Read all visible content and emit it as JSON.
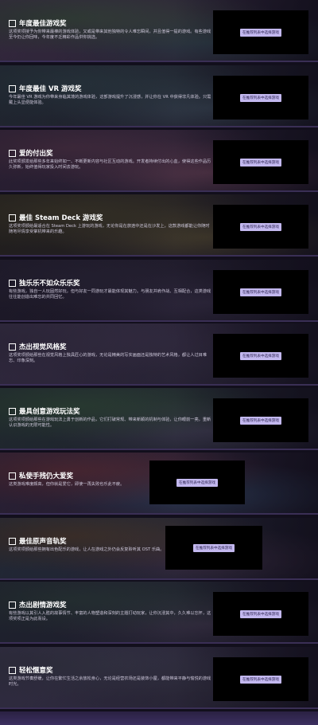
{
  "awards": [
    {
      "title": "年度最佳游戏奖",
      "description": "这项奖项授予为你带来最棒的游戏体验，又或是带来其他独特的令人难忘瞬间，并且值得一提的游戏。有些游戏至今仍让你回味，今年度不乏精彩作品供你挑选。",
      "button": "在推荐列表中选择游戏",
      "colors": [
        "#3b4a3f",
        "#2f3d48",
        "#4a3a55"
      ]
    },
    {
      "title": "年度最佳 VR 游戏奖",
      "description": "今年最佳 VR 游戏为你带来身临其境的游戏体验，这部游戏提升了沉浸感，并让你在 VR 中获得非凡体验。只需戴上头显便能体验。",
      "button": "在推荐列表中选择游戏",
      "colors": [
        "#2e3d45",
        "#36414f",
        "#2c3640"
      ]
    },
    {
      "title": "爱的付出奖",
      "description": "此奖项颁发给那些多年来始终如一、不断更新内容与社区互动的游戏。开发者持续付出的心血，使得这些作品历久弥新，始终值得玩家投入时间去游玩。",
      "button": "在推荐列表中选择游戏",
      "colors": [
        "#4d3347",
        "#5a3a4e",
        "#3a2c44"
      ]
    },
    {
      "title": "最佳 Steam Deck 游戏奖",
      "description": "这项奖项颁给最适合在 Steam Deck 上游玩的游戏，无论你是在旅途中还是在沙发上，这款游戏都能让你随时随地尽情享受掌机带来的乐趣。",
      "button": "在推荐列表中选择游戏",
      "colors": [
        "#3f3a2a",
        "#4a4230",
        "#2f2c25"
      ]
    },
    {
      "title": "独乐乐不如众乐乐奖",
      "description": "有些游戏，独自一人玩固然好玩，但与好友一同游玩才最能体现其魅力。与朋友并肩作战、互相配合，这类游戏往往能创造出难忘的共同回忆。",
      "button": "在推荐列表中选择游戏",
      "colors": [
        "#2b2638",
        "#332c42",
        "#272233"
      ]
    },
    {
      "title": "杰出视觉风格奖",
      "description": "这项奖项颁给那些在视觉风格上独具匠心的游戏，无论是精美的写实画面还是独特的艺术风格，都让人过目难忘、印象深刻。",
      "button": "在推荐列表中选择游戏",
      "colors": [
        "#3a3248",
        "#2f2a3d",
        "#443a55"
      ]
    },
    {
      "title": "最具创意游戏玩法奖",
      "description": "这项奖项颁给那些在游戏玩法上勇于创新的作品，它们打破常规、带来新颖的机制与体验，让你眼前一亮，重新认识游戏的无限可能性。",
      "button": "在推荐列表中选择游戏",
      "colors": [
        "#324a3a",
        "#3d3a4f",
        "#2c3a3f"
      ]
    },
    {
      "title": "私使手残仍大爱奖",
      "description": "这类游戏难度颇高，但你就是爱它，即使一再失败也乐此不疲。",
      "button": "在推荐列表中选择游戏",
      "colors": [
        "#5a2f3a",
        "#2f3f5a",
        "#3a2d47"
      ]
    },
    {
      "title": "最佳原声音轨奖",
      "description": "这项奖项颁给那些拥有出色配乐的游戏，让人在游戏之外仍会反复聆听其 OST 乐曲。",
      "button": "在推荐列表中选择游戏",
      "colors": [
        "#4a3a2f",
        "#3d2f45",
        "#2f3a4a"
      ]
    },
    {
      "title": "杰出剧情游戏奖",
      "description": "有些游戏以其引人入胜的故事情节、丰富的人物塑造和深刻的主题打动玩家，让你沉浸其中，久久难以忘怀，这项奖项正是为此而设。",
      "button": "在推荐列表中选择游戏",
      "colors": [
        "#2c3a3a",
        "#3a3347",
        "#2a2f3d"
      ]
    },
    {
      "title": "轻松惬意奖",
      "description": "这类游戏节奏舒缓，让你在繁忙生活之余放松身心，无论是经营农场还是装饰小屋，都能带来平静与愉悦的游戏时光。",
      "button": "在推荐列表中选择游戏",
      "colors": [
        "#3a3a4a",
        "#2f2c3d",
        "#45405a"
      ]
    }
  ]
}
